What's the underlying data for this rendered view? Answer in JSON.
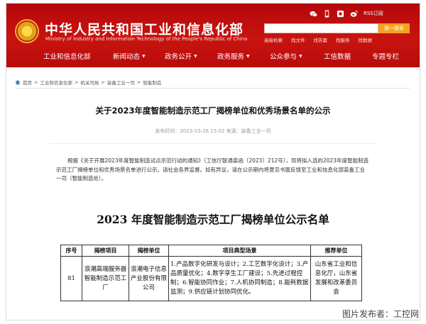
{
  "header": {
    "site_title": "中华人民共和国工业和信息化部",
    "site_subtitle": "Ministry of Industry and Information Technology of the People's Republic of China",
    "rss_label": "RSS订阅",
    "search_placeholder": "",
    "search_button": "搜一搜索",
    "quick_links": [
      "高级检索",
      "找文件",
      "找答案",
      "找服务",
      "找数据"
    ],
    "nav": [
      "工业和信息化部",
      "新闻动态",
      "政务公开",
      "政务服务",
      "公众参与",
      "工信数据",
      "专题专栏"
    ],
    "colors": {
      "brand_red": "#c8140f",
      "search_button": "#f3a31d"
    }
  },
  "breadcrumb": [
    "首页",
    "工业和信息化部",
    "机关司局",
    "装备工业一司",
    "智能制造"
  ],
  "article": {
    "title": "关于2023年度智能制造示范工厂揭榜单位和优秀场景名单的公示",
    "meta": "发布时间：2023-10-26 15:02    来源：装备工业一司",
    "body": "根据《关于开展2023年度智能制造试点示范行动的通知》（工信厅联通装函〔2023〕212号），现将拟入选的2023年度智能制造示范工厂揭榜单位和优秀场景名单进行公示。请社会各界监督。如有异议，请在公示期内将意见书面反馈至工业和信息化部装备工业一司（智能制造处）。"
  },
  "list": {
    "title": "2023 年度智能制造示范工厂揭榜单位公示名单",
    "headers": [
      "序号",
      "揭榜项目",
      "揭榜单位",
      "项目典型场景",
      "推荐单位"
    ],
    "rows": [
      {
        "no": "81",
        "project": "浪潮高端服务器智能制造示范工厂",
        "unit": "浪潮电子信息产业股份有限公司",
        "scenes": "1.产品数字化研发与设计；2.工艺数字化设计；3.产品质量优化；4.数字孪生工厂建设；5.先进过程控制；6.智能协同作业；7.人机协同制造；8.能耗数据监测；9.供应链计划协同优化。",
        "recommender": "山东省工业和信息化厅，山东省发展和改革委员会"
      }
    ]
  },
  "watermark": "图片发布者：工控网"
}
